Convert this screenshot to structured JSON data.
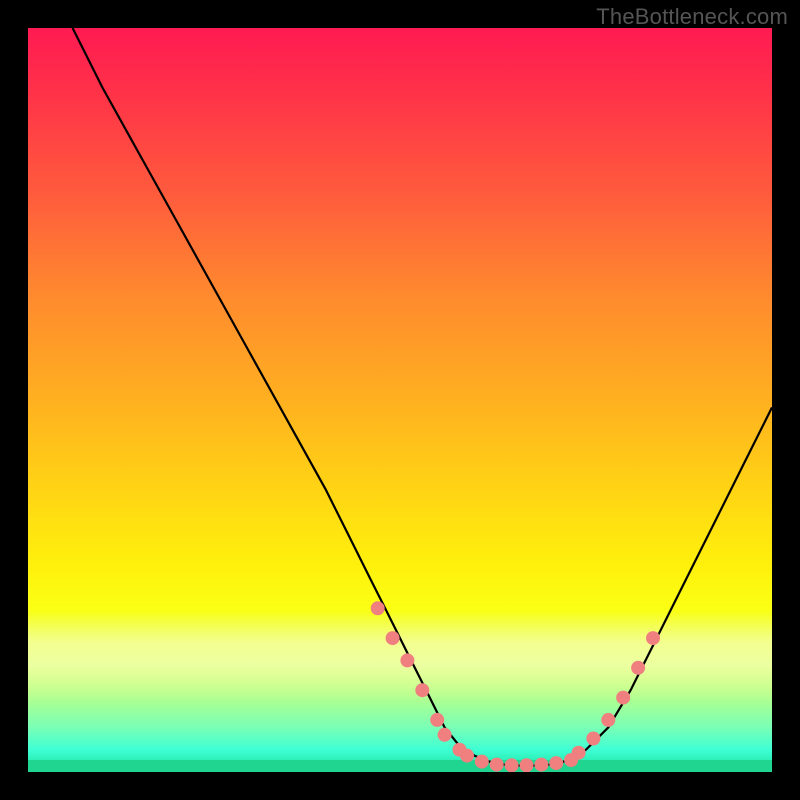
{
  "watermark": "TheBottleneck.com",
  "chart_data": {
    "type": "line",
    "title": "",
    "xlabel": "",
    "ylabel": "",
    "xlim": [
      0,
      100
    ],
    "ylim": [
      0,
      100
    ],
    "series": [
      {
        "name": "curve",
        "x": [
          6,
          10,
          15,
          20,
          25,
          30,
          35,
          40,
          43,
          46,
          49,
          51,
          54,
          56,
          58,
          60,
          62,
          64,
          67,
          70,
          73,
          75,
          78,
          81,
          84,
          88,
          92,
          96,
          100
        ],
        "y": [
          100,
          92,
          83,
          74,
          65,
          56,
          47,
          38,
          32,
          26,
          20,
          16,
          10,
          6,
          3.5,
          2.2,
          1.4,
          1.0,
          0.8,
          1.0,
          1.6,
          3.0,
          6,
          11,
          17,
          25,
          33,
          41,
          49
        ]
      }
    ],
    "markers": [
      {
        "x": 47,
        "y": 22
      },
      {
        "x": 49,
        "y": 18
      },
      {
        "x": 51,
        "y": 15
      },
      {
        "x": 53,
        "y": 11
      },
      {
        "x": 55,
        "y": 7
      },
      {
        "x": 56,
        "y": 5
      },
      {
        "x": 58,
        "y": 3
      },
      {
        "x": 59,
        "y": 2.2
      },
      {
        "x": 61,
        "y": 1.4
      },
      {
        "x": 63,
        "y": 1.0
      },
      {
        "x": 65,
        "y": 0.9
      },
      {
        "x": 67,
        "y": 0.9
      },
      {
        "x": 69,
        "y": 1.0
      },
      {
        "x": 71,
        "y": 1.2
      },
      {
        "x": 73,
        "y": 1.6
      },
      {
        "x": 74,
        "y": 2.6
      },
      {
        "x": 76,
        "y": 4.5
      },
      {
        "x": 78,
        "y": 7
      },
      {
        "x": 80,
        "y": 10
      },
      {
        "x": 82,
        "y": 14
      },
      {
        "x": 84,
        "y": 18
      }
    ],
    "marker_color": "#f08080",
    "curve_color": "#000000"
  }
}
